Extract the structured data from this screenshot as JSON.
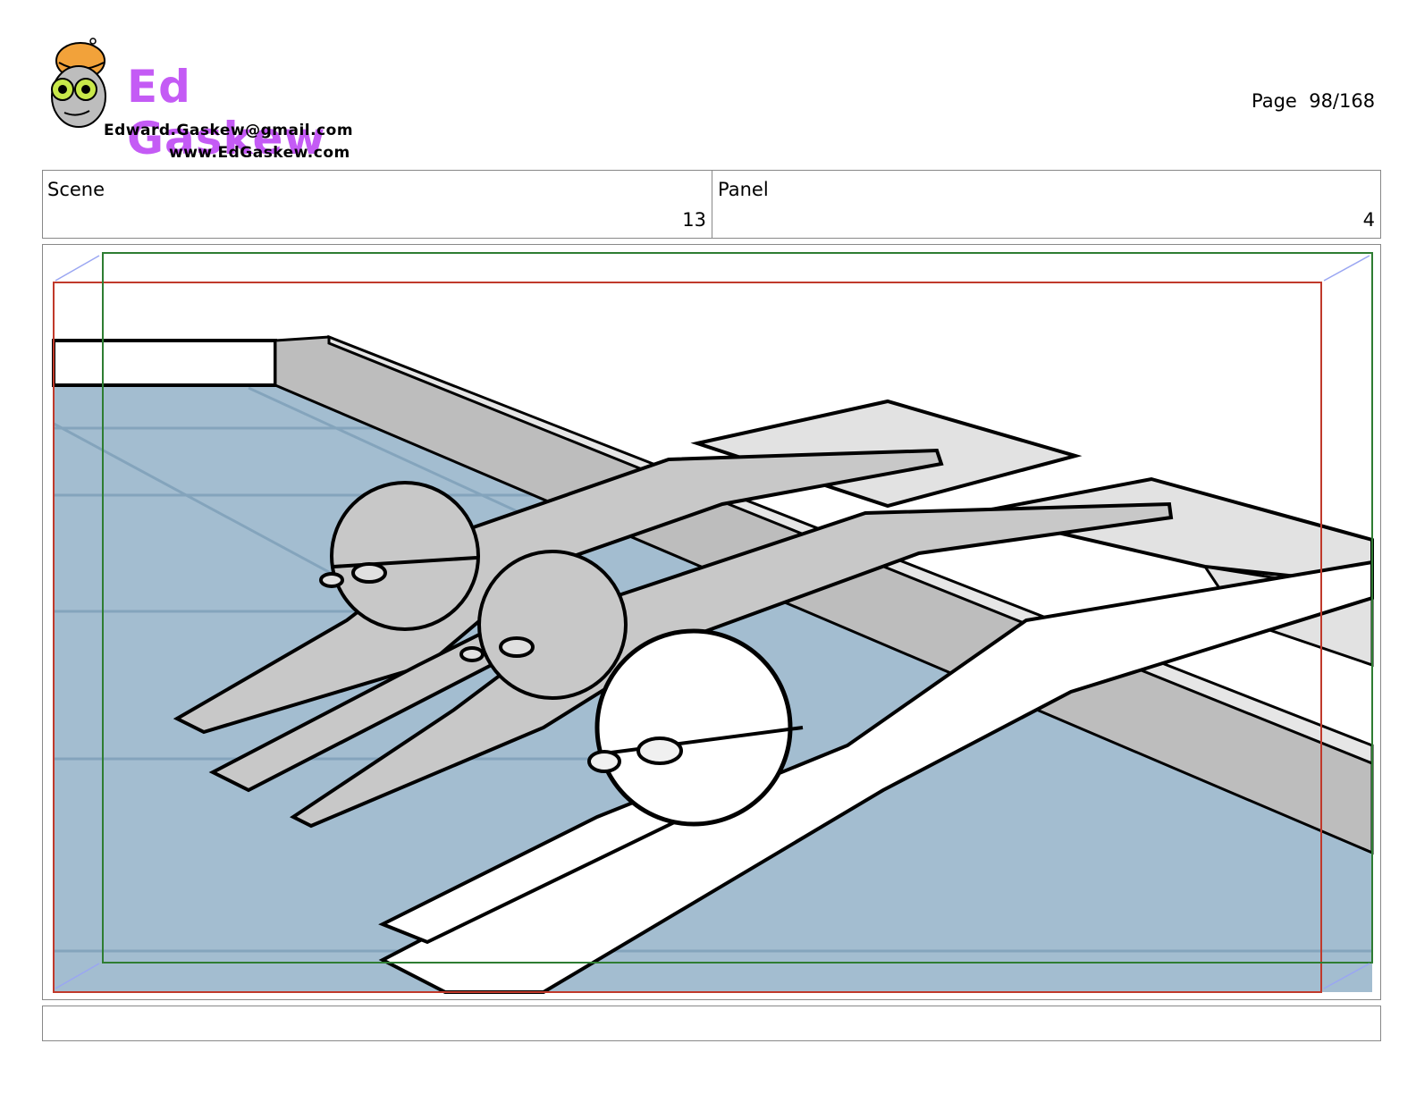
{
  "logo": {
    "first_name": "Ed",
    "last_name": "Gaskew",
    "email": "Edward.Gaskew@gmail.com",
    "website": "www.EdGaskew.com"
  },
  "page": {
    "label": "Page",
    "number": "98/168"
  },
  "header": {
    "scene_label": "Scene",
    "scene_value": "13",
    "panel_label": "Panel",
    "panel_value": "4"
  },
  "colors": {
    "pool_water": "#a3bdd0",
    "swimmer_gray": "#c8c8c8",
    "safe_frame_red": "#c0392b",
    "camera_frame_green": "#2e7d32",
    "arrow_blue": "#9aa6f2"
  }
}
